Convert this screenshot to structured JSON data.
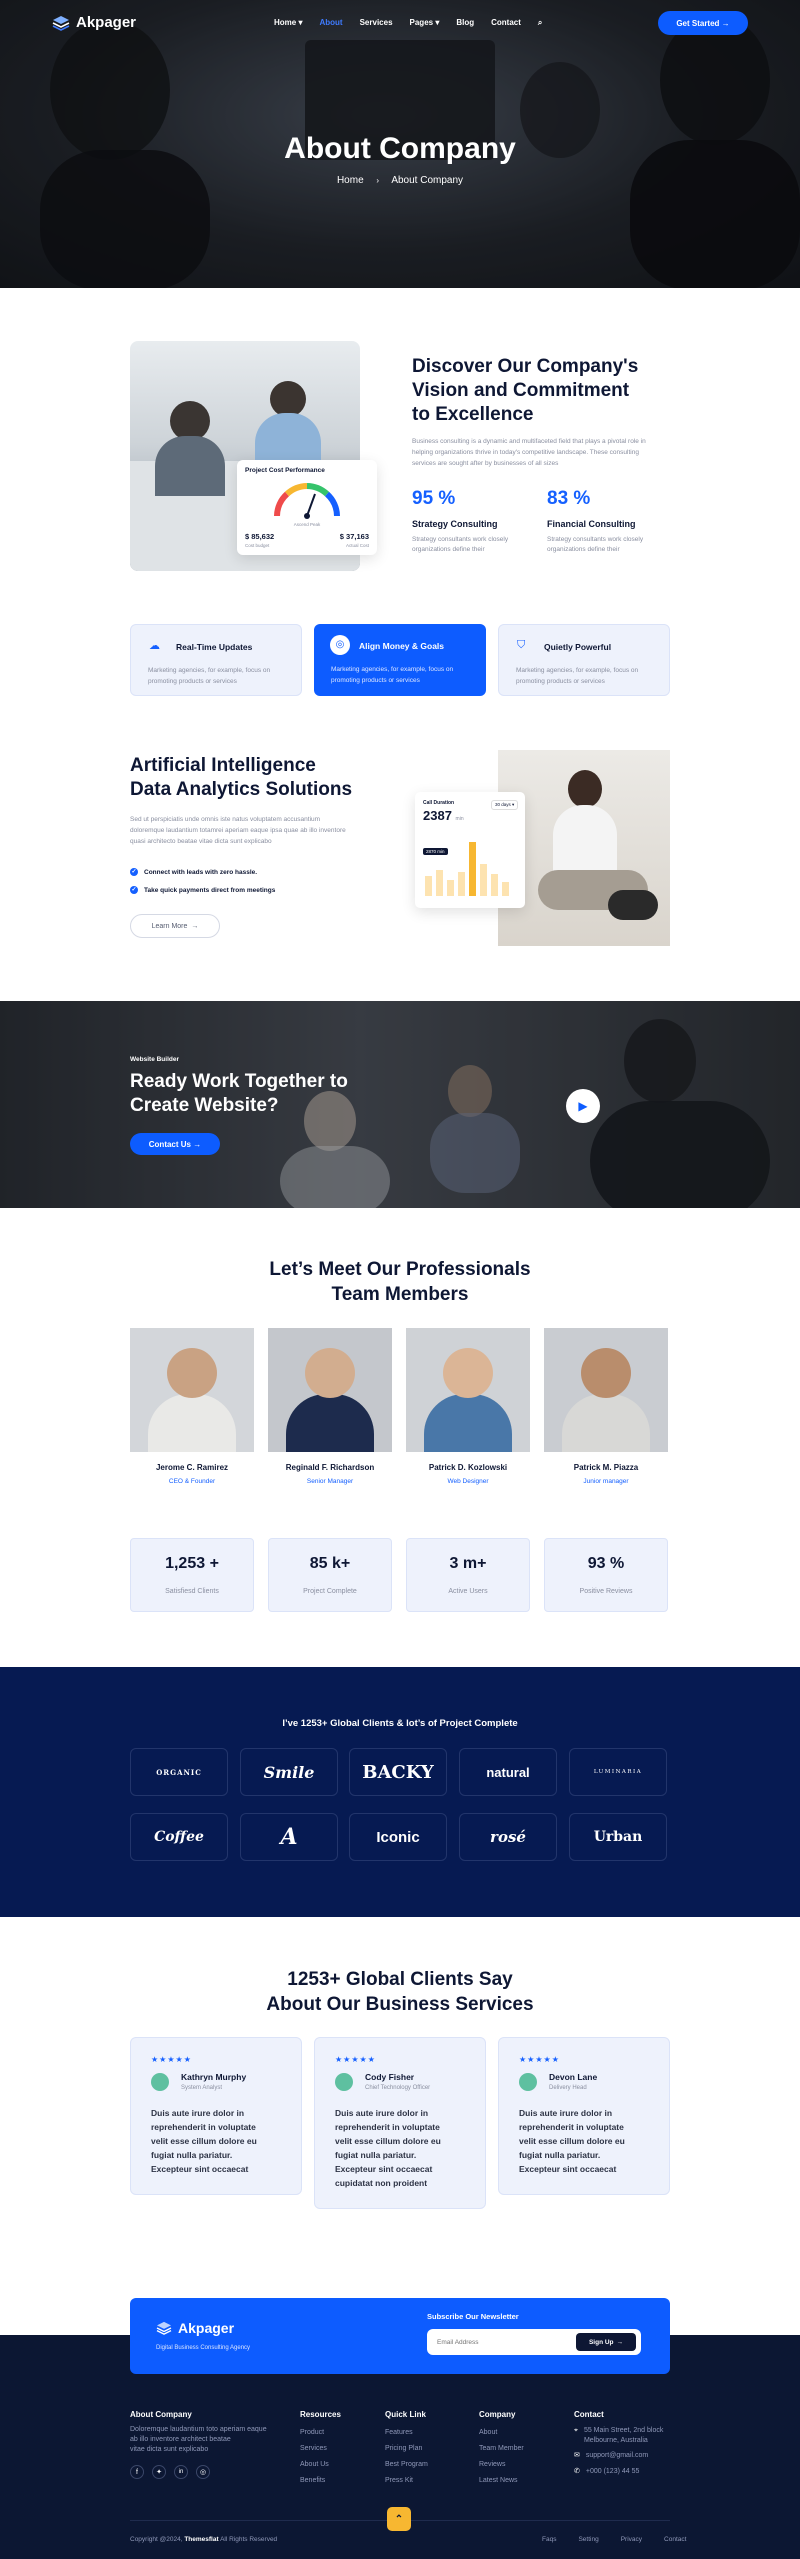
{
  "brand": {
    "name": "Akpager",
    "tagline": "Digital Business Consulting Agency"
  },
  "nav": {
    "items": [
      "Home",
      "About",
      "Services",
      "Pages",
      "Blog",
      "Contact"
    ],
    "cta": "Get Started"
  },
  "hero": {
    "title": "About Company",
    "crumb_home": "Home",
    "crumb_current": "About Company"
  },
  "discover": {
    "title_l1": "Discover Our Company's",
    "title_l2": "Vision and Commitment",
    "title_l3": "to Excellence",
    "desc_l1": "Business consulting is a dynamic and multifaceted field that plays a pivotal role in",
    "desc_l2": "helping organizations thrive in today's competitive landscape. These consulting",
    "desc_l3": "services are sought after by businesses of all sizes",
    "stat1_value": "95 %",
    "stat1_title": "Strategy Consulting",
    "stat1_desc_l1": "Strategy consultants work closely",
    "stat1_desc_l2": "organizations define their",
    "stat2_value": "83 %",
    "stat2_title": "Financial Consulting",
    "stat2_desc_l1": "Strategy consultants work closely",
    "stat2_desc_l2": "organizations define their",
    "widget_title": "Project Cost Performance",
    "widget_gauge_label": "Ascend Peak",
    "widget_left_value": "$ 85,632",
    "widget_left_label": "Cost budget",
    "widget_right_value": "$ 37,163",
    "widget_right_label": "Actual Cost"
  },
  "features": [
    {
      "title": "Real-Time Updates",
      "desc_l1": "Marketing agencies, for example, focus on",
      "desc_l2": "promoting products or services"
    },
    {
      "title": "Align Money & Goals",
      "desc_l1": "Marketing agencies, for example, focus on",
      "desc_l2": "promoting products or services"
    },
    {
      "title": "Quietly Powerful",
      "desc_l1": "Marketing agencies, for example, focus on",
      "desc_l2": "promoting products or services"
    }
  ],
  "ai": {
    "title_l1": "Artificial Intelligence",
    "title_l2": "Data Analytics Solutions",
    "desc_l1": "Sed ut perspiciatis unde omnis iste natus voluptatem accusantium",
    "desc_l2": "doloremque laudantium totamrei aperiam eaque ipsa quae ab illo inventore",
    "desc_l3": "quasi architecto beatae vitae dicta sunt explicabo",
    "check1": "Connect with leads with zero hassle.",
    "check2": "Take quick payments direct from meetings",
    "btn": "Learn More",
    "widget_label": "Call Duration",
    "widget_value": "2387",
    "widget_unit": "min",
    "widget_filter": "30 days",
    "widget_tooltip": "2870 min"
  },
  "cta_band": {
    "eyebrow": "Website Builder",
    "title_l1": "Ready Work Together to",
    "title_l2": "Create Website?",
    "btn": "Contact Us"
  },
  "team": {
    "title_l1": "Let’s Meet Our Professionals",
    "title_l2": "Team Members",
    "members": [
      {
        "name": "Jerome C. Ramirez",
        "role": "CEO & Founder"
      },
      {
        "name": "Reginald F. Richardson",
        "role": "Senior Manager"
      },
      {
        "name": "Patrick D. Kozlowski",
        "role": "Web Designer"
      },
      {
        "name": "Patrick M. Piazza",
        "role": "Junior manager"
      }
    ]
  },
  "stats": [
    {
      "value": "1,253 +",
      "label": "Satisfiesd Clients"
    },
    {
      "value": "85 k+",
      "label": "Project Complete"
    },
    {
      "value": "3 m+",
      "label": "Active Users"
    },
    {
      "value": "93 %",
      "label": "Positive Reviews"
    }
  ],
  "clients": {
    "title": "I’ve 1253+ Global Clients & lot’s of Project Complete",
    "logos": [
      "ORGANIC",
      "Smile",
      "BACKY",
      "natural",
      "LUMINARIA",
      "Coffee",
      "A",
      "Iconic",
      "rosé",
      "Urban"
    ]
  },
  "testimonials": {
    "title_l1": "1253+ Global Clients Say",
    "title_l2": "About Our Business Services",
    "items": [
      {
        "name": "Kathryn Murphy",
        "role": "System Analyst",
        "q1": "Duis aute irure dolor in",
        "q2": "reprehenderit in voluptate",
        "q3": "velit esse cillum dolore eu",
        "q4": "fugiat nulla pariatur.",
        "q5": "Excepteur sint occaecat"
      },
      {
        "name": "Cody Fisher",
        "role": "Chief Technology Officer",
        "q1": "Duis aute irure dolor in",
        "q2": "reprehenderit in voluptate",
        "q3": "velit esse cillum dolore eu",
        "q4": "fugiat nulla pariatur.",
        "q5": "Excepteur sint occaecat",
        "q6": "cupidatat non proident"
      },
      {
        "name": "Devon Lane",
        "role": "Delivery Head",
        "q1": "Duis aute irure dolor in",
        "q2": "reprehenderit in voluptate",
        "q3": "velit esse cillum dolore eu",
        "q4": "fugiat nulla pariatur.",
        "q5": "Excepteur sint occaecat",
        "q6": "cupidatat non proident"
      }
    ]
  },
  "newsletter": {
    "title": "Subscribe Our Newsletter",
    "placeholder": "Email Address",
    "btn": "Sign Up"
  },
  "footer": {
    "about_title": "About Company",
    "about_l1": "Doloremque laudantium toto aperiam eaque",
    "about_l2": "ab illo inventore architect beatae",
    "about_l3": "vitae dicta sunt explicabo",
    "resources": {
      "title": "Resources",
      "items": [
        "Product",
        "Services",
        "About Us",
        "Benefits"
      ]
    },
    "quick": {
      "title": "Quick Link",
      "items": [
        "Features",
        "Pricing Plan",
        "Best Program",
        "Press Kit"
      ]
    },
    "company": {
      "title": "Company",
      "items": [
        "About",
        "Team Member",
        "Reviews",
        "Latest News"
      ]
    },
    "contact": {
      "title": "Contact",
      "addr_l1": "55 Main Street, 2nd block",
      "addr_l2": "Melbourne, Australia",
      "email": "support@gmail.com",
      "phone": "+000 (123) 44 55"
    },
    "copyright_pre": "Copyright @2024,",
    "copyright_brand": "Themesflat",
    "copyright_post": "All Rights Reserved",
    "links": [
      "Faqs",
      "Setting",
      "Privacy",
      "Contact"
    ]
  }
}
